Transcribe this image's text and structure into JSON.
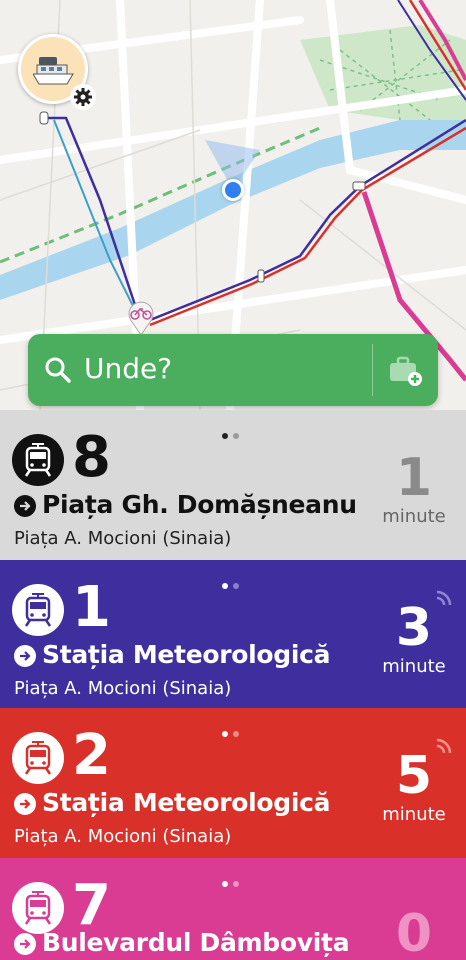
{
  "colors": {
    "map_bg": "#f1f0ec",
    "search_green": "#4aae5e",
    "card_8_bg": "#d9d9d9",
    "card_1_bg": "#3f2f9e",
    "card_2_bg": "#d9302a",
    "card_7_bg": "#d93c92",
    "user_location": "#2f7ff0"
  },
  "map": {
    "avatar_icon": "boat-icon",
    "settings_icon": "gear-icon",
    "poi_icon": "bicycle-icon"
  },
  "search": {
    "label": "Unde?",
    "search_icon": "search-icon",
    "briefcase_icon": "briefcase-add-icon"
  },
  "cards": [
    {
      "route": "8",
      "destination": "Piața Gh. Domășneanu",
      "stop": "Piața A. Mocioni (Sinaia)",
      "minutes": "1",
      "minutes_label": "minute",
      "live": false,
      "vehicle_icon": "tram-icon"
    },
    {
      "route": "1",
      "destination": "Stația Meteorologică",
      "stop": "Piața A. Mocioni (Sinaia)",
      "minutes": "3",
      "minutes_label": "minute",
      "live": true,
      "vehicle_icon": "tram-icon"
    },
    {
      "route": "2",
      "destination": "Stația Meteorologică",
      "stop": "Piața A. Mocioni (Sinaia)",
      "minutes": "5",
      "minutes_label": "minute",
      "live": true,
      "vehicle_icon": "tram-icon"
    },
    {
      "route": "7",
      "destination": "Bulevardul Dâmbovița",
      "stop": "",
      "minutes": "0",
      "minutes_label": "",
      "live": false,
      "vehicle_icon": "tram-icon"
    }
  ]
}
